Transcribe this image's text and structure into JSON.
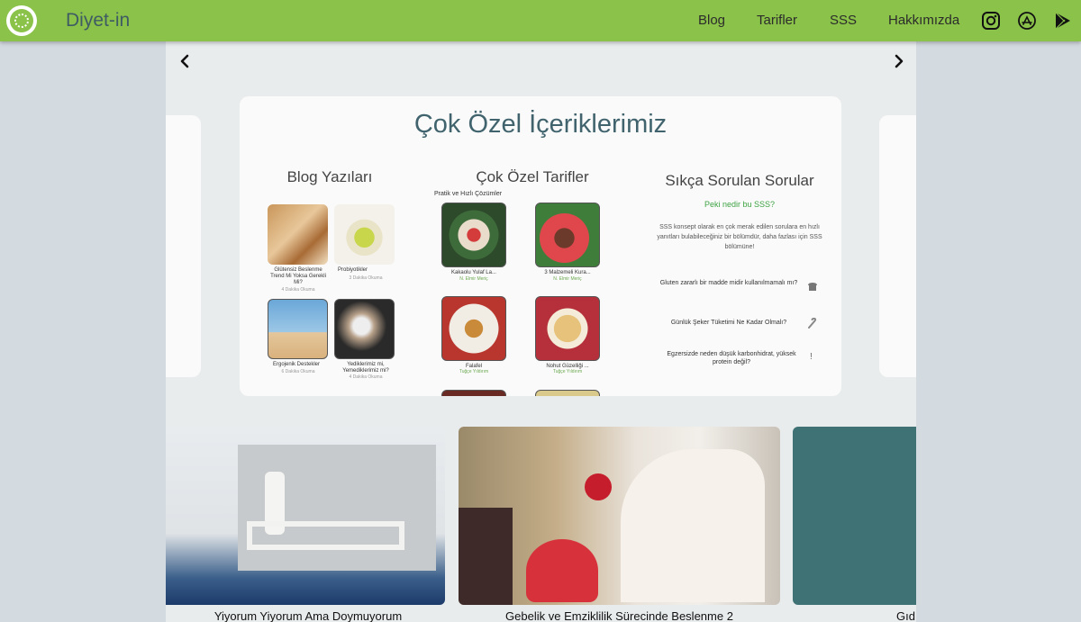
{
  "nav": {
    "brand": "Diyet-in",
    "links": [
      "Blog",
      "Tarifler",
      "SSS",
      "Hakkımızda"
    ],
    "icons": [
      "instagram-icon",
      "app-store-icon",
      "google-play-icon"
    ],
    "color": "#8bc34a"
  },
  "featured": {
    "title": "Çok Özel İçeriklerimiz",
    "blog": {
      "title": "Blog Yazıları",
      "posts": [
        {
          "title": "Glütensiz Beslenme Trend Mi Yoksa Gerekli Mi?",
          "read": "4 Dakika Okuma"
        },
        {
          "title": "Probiyotikler",
          "read": "3 Dakika Okuma"
        },
        {
          "title": "Ergojenik Destekler",
          "read": "6 Dakika Okuma"
        },
        {
          "title": "Yediklerimiz mi, Yemediklerimiz mi?",
          "read": "4 Dakika Okuma"
        }
      ]
    },
    "recipes": {
      "title": "Çok Özel Tarifler",
      "subtitle": "Pratik ve Hızlı Çözümler",
      "items": [
        {
          "title": "Kakaolu Yulaf La...",
          "author": "N. Elmir Meriç"
        },
        {
          "title": "3 Malzemeli Kura...",
          "author": "N. Elmir Meriç"
        },
        {
          "title": "Falafel",
          "author": "Tuğçe Yıldırım"
        },
        {
          "title": "Nohut Güzelliği ...",
          "author": "Tuğçe Yıldırım"
        }
      ]
    },
    "faq": {
      "title": "Sıkça Sorulan Sorular",
      "subtitle": "Peki nedir bu SSS?",
      "description": "SSS konsept olarak en çok merak edilen sorulara en hızlı yanıtları bulabileceğiniz bir bölümdür, daha fazlası için SSS bölümüne!",
      "questions": [
        {
          "text": "Gluten zararlı bir madde midir kullanılmamalı mı?",
          "icon": "bread-icon"
        },
        {
          "text": "Günlük Şeker Tüketimi Ne Kadar Olmalı?",
          "icon": "candy-cane-icon"
        },
        {
          "text": "Egzersizde neden düşük karbonhidrat, yüksek protein değil?",
          "icon": "exclamation-icon"
        }
      ]
    }
  },
  "carousel": [
    {
      "title": "Yiyorum Yiyorum Ama Doymuyorum"
    },
    {
      "title": "Gebelik ve Emziklilik Sürecinde Beslenme 2"
    },
    {
      "title": "Gıd"
    }
  ]
}
